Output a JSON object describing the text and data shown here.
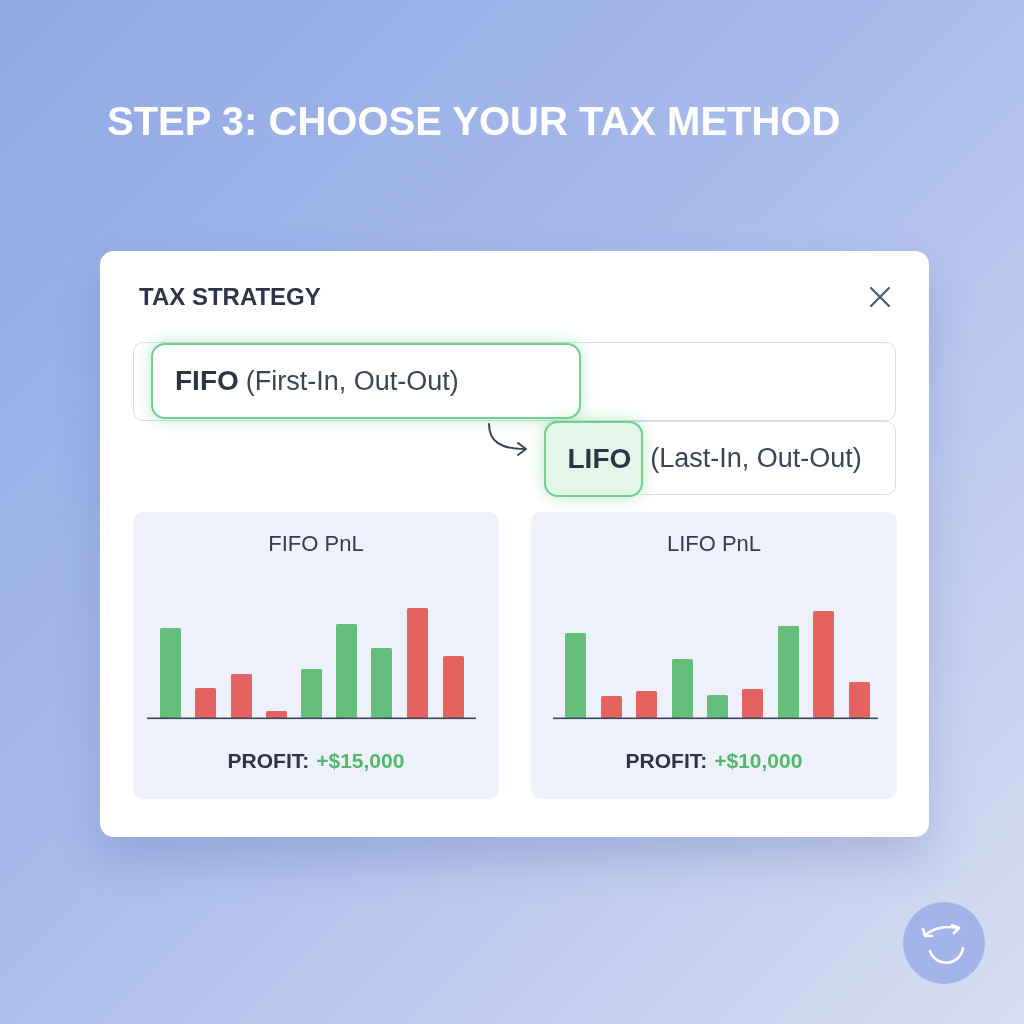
{
  "heading": "STEP 3: CHOOSE YOUR TAX METHOD",
  "dialog": {
    "title": "TAX STRATEGY",
    "options": [
      {
        "label": "FIFO",
        "description": "(First-In, Out-Out)",
        "selected": true,
        "highlighted": false
      },
      {
        "label": "LIFO",
        "description": "(Last-In, Out-Out)",
        "selected": false,
        "highlighted": true
      }
    ],
    "panels": [
      {
        "title": "FIFO PnL",
        "profit_label": "PROFIT:",
        "profit_value": "+$15,000"
      },
      {
        "title": "LIFO PnL",
        "profit_label": "PROFIT:",
        "profit_value": "+$10,000"
      }
    ]
  }
}
